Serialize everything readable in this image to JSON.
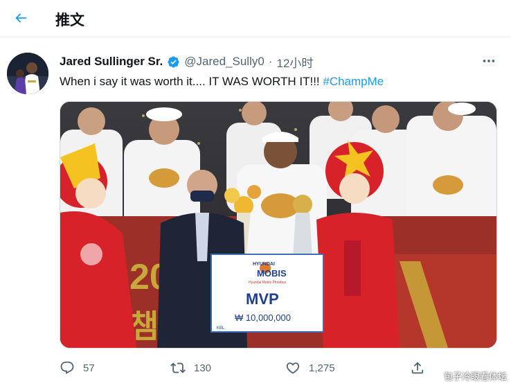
{
  "header": {
    "title": "推文"
  },
  "tweet": {
    "author_name": "Jared Sullinger Sr.",
    "handle": "@Jared_Sully0",
    "separator": "·",
    "time": "12小时",
    "text": "When i say it was worth it.... IT WAS WORTH IT!!! ",
    "hashtag": "#ChampMe"
  },
  "media": {
    "check_brand_top": "HYUNDAI",
    "check_brand": "MOBIS",
    "check_subtitle": "Hyundai Mobis Phoebus",
    "check_title": "MVP",
    "check_amount": "₩ 10,000,000",
    "check_footer": "KBL",
    "banner_text": "20",
    "banner_text_bottom": "챔"
  },
  "actions": {
    "replies": "57",
    "retweets": "130",
    "likes": "1,275"
  },
  "watermark": "包子冷眼看体坛",
  "colors": {
    "accent": "#1d9bf0",
    "text_primary": "#0f1419",
    "text_secondary": "#536471",
    "mascot_red": "#d8222a",
    "banner_red": "#a0302a",
    "gold": "#c8a83a"
  },
  "icons": {
    "back": "arrow-left-icon",
    "verified": "verified-badge-icon",
    "more": "more-dots-icon",
    "reply": "reply-icon",
    "retweet": "retweet-icon",
    "like": "heart-icon",
    "share": "share-icon"
  }
}
